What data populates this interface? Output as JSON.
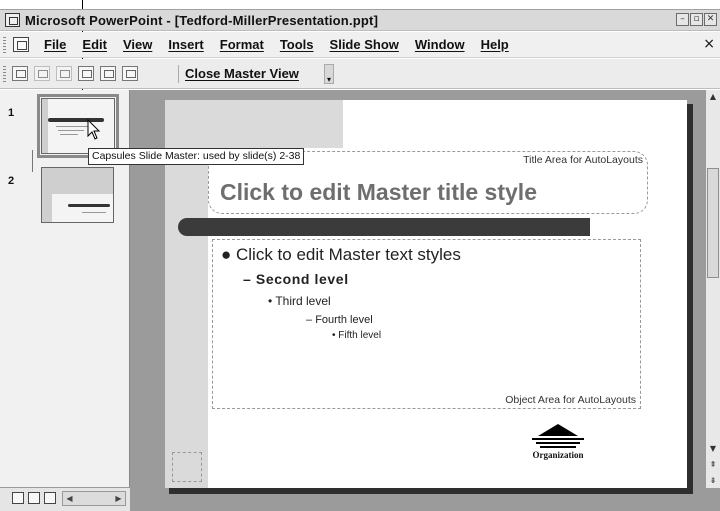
{
  "window": {
    "title": "Microsoft PowerPoint - [Tedford-MillerPresentation.ppt]",
    "buttons": [
      "minimize-icon",
      "restore-icon",
      "close-icon"
    ]
  },
  "menu": {
    "items": [
      "File",
      "Edit",
      "View",
      "Insert",
      "Format",
      "Tools",
      "Slide Show",
      "Window",
      "Help"
    ],
    "close_glyph": "×"
  },
  "toolbar": {
    "close_master_label": "Close Master View",
    "chevron_glyph": "▾"
  },
  "slides_pane": {
    "thumbnails": [
      {
        "number": "1"
      },
      {
        "number": "2"
      }
    ],
    "tooltip": "Capsules Slide Master: used by slide(s) 2-38"
  },
  "slide": {
    "title_area_label": "Title Area for AutoLayouts",
    "title_text": "Click to edit Master title style",
    "object_area_label": "Object Area for AutoLayouts",
    "bullets": {
      "level1": "Click to edit Master text styles",
      "level2": "Second level",
      "level3": "Third level",
      "level4": "Fourth level",
      "level5": "Fifth level"
    },
    "logo_text": "Organization"
  },
  "colors": {
    "workspace": "#9b9b9b",
    "slide_background": "#ffffff",
    "title_text": "#6e6e6e",
    "capsule_bar": "#3b3b3b"
  }
}
